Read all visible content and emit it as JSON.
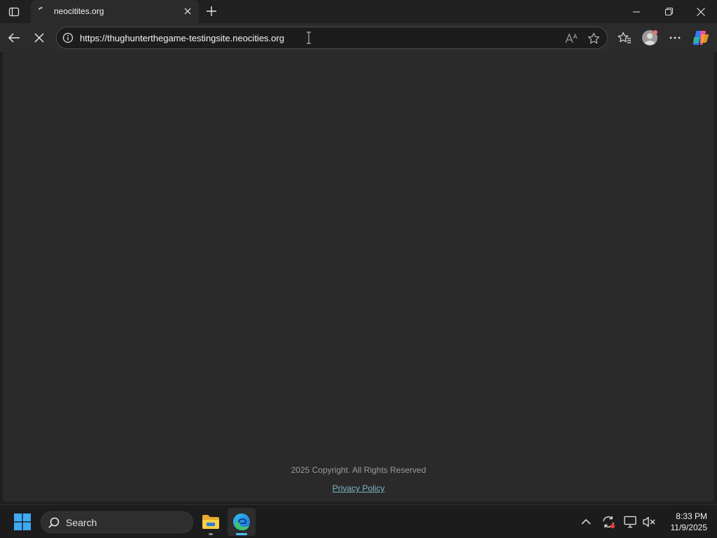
{
  "browser": {
    "tab": {
      "title": "neocitites.org"
    },
    "address_bar": {
      "url": "https://thughunterthegame-testingsite.neocities.org"
    }
  },
  "page": {
    "footer": {
      "copyright": "2025 Copyright. All Rights Reserved",
      "privacy_link": "Privacy Policy"
    }
  },
  "taskbar": {
    "search_label": "Search",
    "clock": {
      "time": "8:33 PM",
      "date": "11/9/2025"
    }
  },
  "icons": {
    "tab_actions": "tab-actions-icon",
    "close": "close-icon",
    "new_tab": "plus-icon",
    "back": "arrow-left-icon",
    "stop": "stop-loading-icon",
    "site_info": "info-icon",
    "read_aloud": "read-aloud-icon",
    "favorite": "star-icon",
    "favorites": "favorites-icon",
    "profile": "profile-icon",
    "more": "more-icon",
    "copilot": "copilot-icon",
    "windows": "windows-icon",
    "search": "search-icon",
    "file_explorer": "folder-icon",
    "edge": "edge-icon"
  },
  "colors": {
    "page_background": "#2a2a2a",
    "link": "#7fb7c9",
    "edge_active": "#4cc2ff"
  }
}
